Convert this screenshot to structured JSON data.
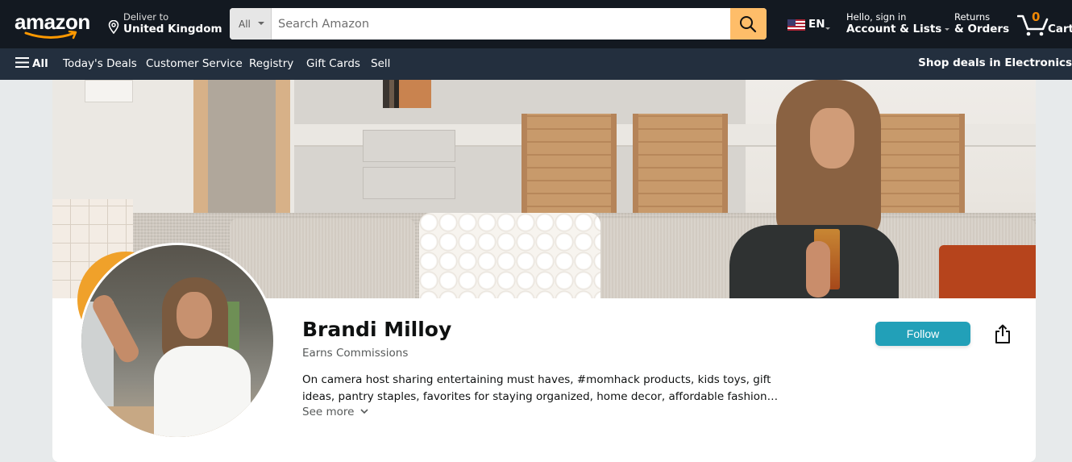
{
  "header": {
    "logo": "amazon",
    "deliver": {
      "line1": "Deliver to",
      "line2": "United Kingdom"
    },
    "search": {
      "category": "All",
      "placeholder": "Search Amazon",
      "value": ""
    },
    "language": {
      "code": "EN",
      "flag": "us-flag"
    },
    "account": {
      "line1": "Hello, sign in",
      "line2": "Account & Lists"
    },
    "returns": {
      "line1": "Returns",
      "line2": "& Orders"
    },
    "cart": {
      "count": "0",
      "label": "Cart"
    }
  },
  "subnav": {
    "all_label": "All",
    "items": [
      "Today's Deals",
      "Customer Service",
      "Registry",
      "Gift Cards",
      "Sell"
    ],
    "promo": "Shop deals in Electronics"
  },
  "profile": {
    "name": "Brandi Milloy",
    "subtitle": "Earns Commissions",
    "bio": "On camera host sharing entertaining must haves, #momhack products, kids toys, gift ideas, pantry staples, favorites for staying organized, home decor, affordable fashion and more!",
    "see_more": "See more",
    "follow_label": "Follow",
    "share_icon": "share-icon"
  },
  "colors": {
    "header_bg": "#131921",
    "subnav_bg": "#232f3e",
    "search_button": "#febd69",
    "cart_count": "#f08804",
    "follow_button": "#22a0b8",
    "page_bg": "#e7eaeb"
  }
}
